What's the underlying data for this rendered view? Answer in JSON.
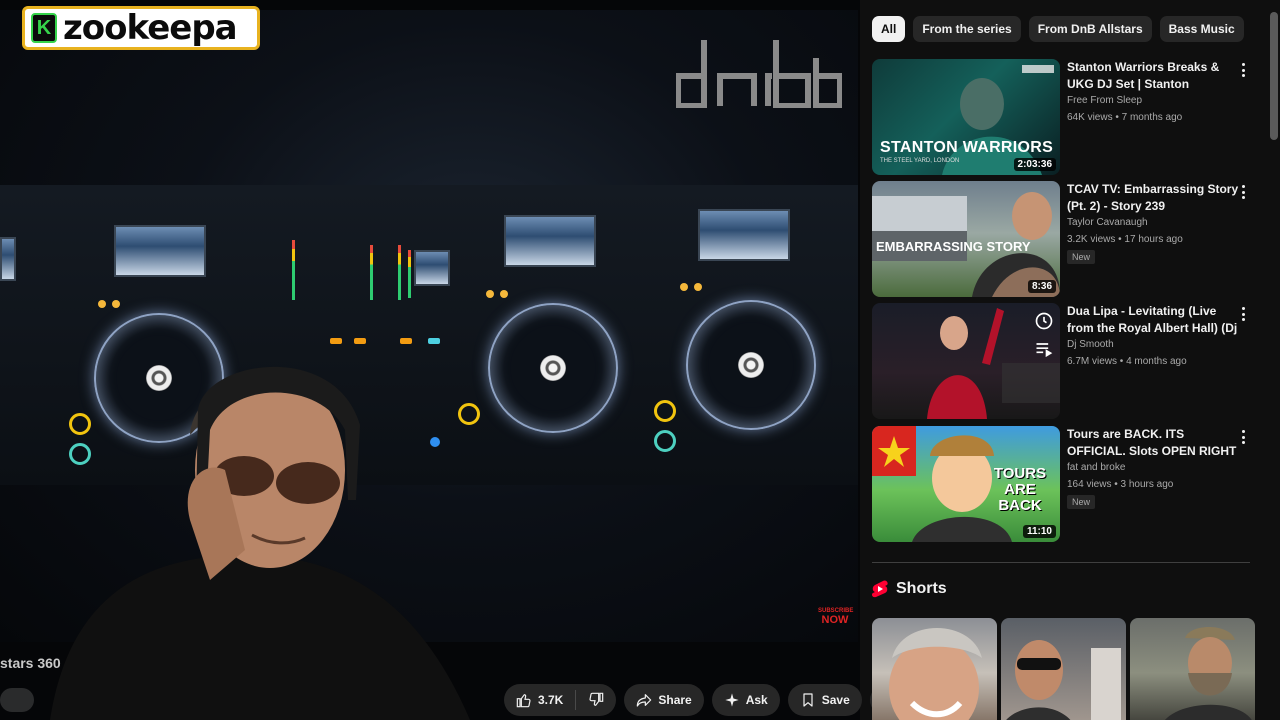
{
  "overlay": {
    "logo_badge": "K",
    "logo_text": "zookeepa",
    "webcam_label": "stars 360",
    "subscribe_text": "SUBSCRIBE NOW"
  },
  "actions": {
    "like_count": "3.7K",
    "share_label": "Share",
    "ask_label": "Ask",
    "save_label": "Save"
  },
  "chips": [
    "All",
    "From the series",
    "From DnB Allstars",
    "Bass Music"
  ],
  "recommendations": [
    {
      "title": "Stanton Warriors Breaks & UKG DJ Set | Stanton Sessions @ The...",
      "channel": "Free From Sleep",
      "stats": "64K views • 7 months ago",
      "duration": "2:03:36",
      "thumb_caption": "STANTON WARRIORS",
      "thumb_subcaption": "THE STEEL YARD, LONDON",
      "badge": ""
    },
    {
      "title": "TCAV TV: Embarrassing Story (Pt. 2) - Story 239",
      "channel": "Taylor Cavanaugh",
      "stats": "3.2K views • 17 hours ago",
      "duration": "8:36",
      "thumb_caption": "EMBARRASSING STORY",
      "thumb_subcaption": "",
      "badge": "New"
    },
    {
      "title": "Dua Lipa - Levitating (Live from the Royal Albert Hall) (Dj Smoot...",
      "channel": "Dj Smooth",
      "stats": "6.7M views • 4 months ago",
      "duration": "",
      "thumb_caption": "",
      "thumb_subcaption": "",
      "badge": ""
    },
    {
      "title": "Tours are BACK.  ITS OFFICIAL. Slots OPEN RIGHT NOW!",
      "channel": "fat and broke",
      "stats": "164 views • 3 hours ago",
      "duration": "11:10",
      "thumb_caption": "TOURS ARE BACK",
      "thumb_subcaption": "",
      "badge": "New"
    }
  ],
  "shorts": {
    "heading": "Shorts"
  },
  "colors": {
    "background": "#0f0f0f",
    "chip": "#272727",
    "chip_active": "#f1f1f1",
    "shorts_red": "#ff0033",
    "logo_border": "#e8b21f"
  }
}
